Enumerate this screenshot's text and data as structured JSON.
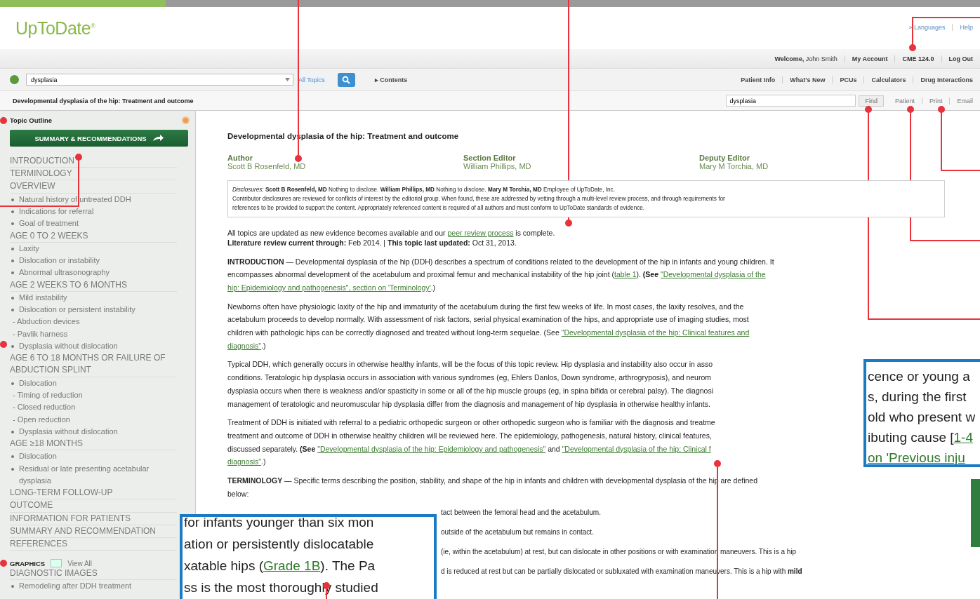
{
  "header": {
    "logo": "UpToDate$^{®}$",
    "top_links": [
      "» Languages",
      "Help"
    ]
  },
  "account_bar": {
    "welcome": "**Welcome,** John Smith",
    "links": [
      "My Account",
      "CME 124.0",
      "Log Out"
    ]
  },
  "search_bar": {
    "value": "dysplasia",
    "scope": "All Topics",
    "contents_link": "▸ Contents",
    "nav_links": [
      "Patient Info",
      "What's New",
      "PCUs",
      "Calculators",
      "Drug Interactions"
    ]
  },
  "topic_bar": {
    "title": "Developmental dysplasia of the hip: Treatment and outcome",
    "find_value": "dysplasia",
    "find_button": "Find",
    "actions": [
      "Patient",
      "Print",
      "Email"
    ]
  },
  "sidebar": {
    "heading": "Topic Outline",
    "summary_button": "SUMMARY & RECOMMENDATIONS",
    "outline": [
      {
        "label": "INTRODUCTION"
      },
      {
        "label": "TERMINOLOGY"
      },
      {
        "label": "OVERVIEW",
        "children": [
          {
            "label": "Natural history of untreated DDH"
          },
          {
            "label": "Indications for referral"
          },
          {
            "label": "Goal of treatment"
          }
        ]
      },
      {
        "label": "AGE 0 TO 2 WEEKS",
        "children": [
          {
            "label": "Laxity"
          },
          {
            "label": "Dislocation or instability"
          },
          {
            "label": "Abnormal ultrasonography"
          }
        ]
      },
      {
        "label": "AGE 2 WEEKS TO 6 MONTHS",
        "children": [
          {
            "label": "Mild instability"
          },
          {
            "label": "Dislocation or persistent instability",
            "children": [
              {
                "label": "- Abduction devices"
              },
              {
                "label": "- Pavlik harness"
              }
            ]
          },
          {
            "label": "Dysplasia without dislocation"
          }
        ]
      },
      {
        "label": "AGE 6 TO 18 MONTHS OR FAILURE OF ABDUCTION SPLINT",
        "children": [
          {
            "label": "Dislocation",
            "children": [
              {
                "label": "- Timing of reduction"
              },
              {
                "label": "- Closed reduction"
              },
              {
                "label": "- Open reduction"
              }
            ]
          },
          {
            "label": "Dysplasia without dislocation"
          }
        ]
      },
      {
        "label": "AGE ≥18 MONTHS",
        "children": [
          {
            "label": "Dislocation"
          },
          {
            "label": "Residual or late presenting acetabular dysplasia"
          }
        ]
      },
      {
        "label": "LONG-TERM FOLLOW-UP"
      },
      {
        "label": "OUTCOME"
      },
      {
        "label": "INFORMATION FOR PATIENTS"
      },
      {
        "label": "SUMMARY AND RECOMMENDATION"
      },
      {
        "label": "REFERENCES"
      }
    ],
    "graphics_heading": "GRAPHICS",
    "view_all": "View All",
    "graphics": [
      {
        "label": "DIAGNOSTIC IMAGES",
        "children": [
          {
            "label": "Remodeling after DDH treatment"
          }
        ]
      }
    ]
  },
  "article": {
    "title": "Developmental dysplasia of the hip: Treatment and outcome",
    "contributors": [
      {
        "role": "Author",
        "name": "Scott B Rosenfeld, MD"
      },
      {
        "role": "Section Editor",
        "name": "William Phillips, MD"
      },
      {
        "role": "Deputy Editor",
        "name": "Mary M Torchia, MD"
      }
    ],
    "disclosures": [
      "*Disclosures:* **Scott B Rosenfeld, MD** Nothing to disclose. **William Phillips, MD** Nothing to disclose. **Mary M Torchia, MD** Employee of UpToDate, Inc.",
      "Contributor disclosures are reviewed for conflicts of interest by the editorial group. When found, these are addressed by vetting through a multi-level review process, and through requirements for",
      "references to be provided to support the content. Appropriately referenced content is required of all authors and must conform to UpToDate standards of evidence."
    ],
    "update_note": [
      [
        {
          "kind": "text",
          "text": "All topics are updated as new evidence becomes available and our "
        },
        {
          "kind": "link",
          "text": "peer review process"
        },
        {
          "kind": "text",
          "text": " is complete."
        }
      ],
      [
        {
          "kind": "text",
          "text": "**Literature review current through:** Feb 2014. | **This topic last updated:** Oct 31, 2013."
        }
      ]
    ],
    "paragraphs": [
      [
        [
          {
            "kind": "text",
            "text": "**INTRODUCTION** — Developmental dysplasia of the hip (DDH) describes a spectrum of conditions related to the development of the hip in infants and young children. It"
          }
        ],
        [
          {
            "kind": "text",
            "text": "encompasses abnormal development of the acetabulum and proximal femur and mechanical instability of the hip joint ("
          },
          {
            "kind": "link",
            "text": "table 1"
          },
          {
            "kind": "text",
            "text": "). **(See** "
          },
          {
            "kind": "link",
            "text": "\"Developmental dysplasia of the"
          }
        ],
        [
          {
            "kind": "link",
            "text": "hip: Epidemiology and pathogenesis\", section on 'Terminology'"
          },
          {
            "kind": "text",
            "text": ".)"
          }
        ]
      ],
      [
        [
          {
            "kind": "text",
            "text": "Newborns often have physiologic laxity of the hip and immaturity of the acetabulum during the first few weeks of life. In most cases, the laxity resolves, and the"
          }
        ],
        [
          {
            "kind": "text",
            "text": "acetabulum proceeds to develop normally. With assessment of risk factors, serial physical examination of the hips, and appropriate use of imaging studies, most"
          }
        ],
        [
          {
            "kind": "text",
            "text": "children with pathologic hips can be correctly diagnosed and treated without long-term sequelae. (See "
          },
          {
            "kind": "link",
            "text": "\"Developmental dysplasia of the hip: Clinical features and"
          }
        ],
        [
          {
            "kind": "link",
            "text": "diagnosis\""
          },
          {
            "kind": "text",
            "text": ".)"
          }
        ]
      ],
      [
        [
          {
            "kind": "text",
            "text": "Typical DDH, which generally occurs in otherwise healthy infants, will be the focus of this topic review. Hip dysplasia and instability also occur in asso"
          }
        ],
        [
          {
            "kind": "text",
            "text": "conditions. Teratologic hip dysplasia occurs in association with various syndromes (eg, Ehlers Danlos, Down syndrome, arthrogryposis), and neurom"
          }
        ],
        [
          {
            "kind": "text",
            "text": "dysplasia occurs when there is weakness and/or spasticity in some or all of the hip muscle groups (eg, in spina bifida or cerebral palsy). The diagnosi"
          }
        ],
        [
          {
            "kind": "text",
            "text": "management of teratologic and neuromuscular hip dysplasia differ from the diagnosis and management of hip dysplasia in otherwise healthy infants."
          }
        ]
      ],
      [
        [
          {
            "kind": "text",
            "text": "Treatment of DDH is initiated with referral to a pediatric orthopedic surgeon or other orthopedic surgeon who is familiar with the diagnosis and treatme"
          }
        ],
        [
          {
            "kind": "text",
            "text": "treatment and outcome of DDH in otherwise healthy children will be reviewed here. The epidemiology, pathogenesis, natural history, clinical features,"
          }
        ],
        [
          {
            "kind": "text",
            "text": "discussed separately. **(See** "
          },
          {
            "kind": "link",
            "text": "\"Developmental dysplasia of the hip: Epidemiology and pathogenesis\""
          },
          {
            "kind": "text",
            "text": " and "
          },
          {
            "kind": "link",
            "text": "\"Developmental dysplasia of the hip: Clinical f"
          }
        ],
        [
          {
            "kind": "link",
            "text": "diagnosis\""
          },
          {
            "kind": "text",
            "text": ".)"
          }
        ]
      ],
      [
        [
          {
            "kind": "text",
            "text": "**TERMINOLOGY** — Specific terms describing the position, stability, and shape of the hip in infants and children with developmental dysplasia of the hip are defined"
          }
        ],
        [
          {
            "kind": "text",
            "text": "below:"
          }
        ]
      ]
    ],
    "term_fragments": [
      "tact between the femoral head and the acetabulum.",
      "outside of the acetabulum but remains in contact.",
      "(ie, within the acetabulum) at rest, but can dislocate in other positions or with examination maneuvers. This is a hip",
      "d is reduced at rest but can be partially dislocated or subluxated with examination maneuvers. This is a hip with **mild**"
    ]
  },
  "zoom_insets": [
    {
      "kind": "right",
      "lines": [
        [
          {
            "kind": "text",
            "text": "cence or young a"
          }
        ],
        [
          {
            "kind": "text",
            "text": "s, during the first"
          }
        ],
        [
          {
            "kind": "text",
            "text": "old who present w"
          }
        ],
        [
          {
            "kind": "text",
            "text": "ibuting cause ["
          },
          {
            "kind": "link",
            "text": "1-4"
          }
        ],
        [
          {
            "kind": "link",
            "text": "on 'Previous inju"
          }
        ]
      ]
    },
    {
      "kind": "bottom",
      "lines": [
        [
          {
            "kind": "text",
            "text": "for infants younger than six mon"
          }
        ],
        [
          {
            "kind": "text",
            "text": "ation or persistently dislocatable"
          }
        ],
        [
          {
            "kind": "text",
            "text": "xatable hips ("
          },
          {
            "kind": "link",
            "text": "Grade 1B"
          },
          {
            "kind": "text",
            "text": "). The Pa"
          }
        ],
        [
          {
            "kind": "text",
            "text": "ss is the most thoroughly studied"
          }
        ]
      ]
    }
  ]
}
